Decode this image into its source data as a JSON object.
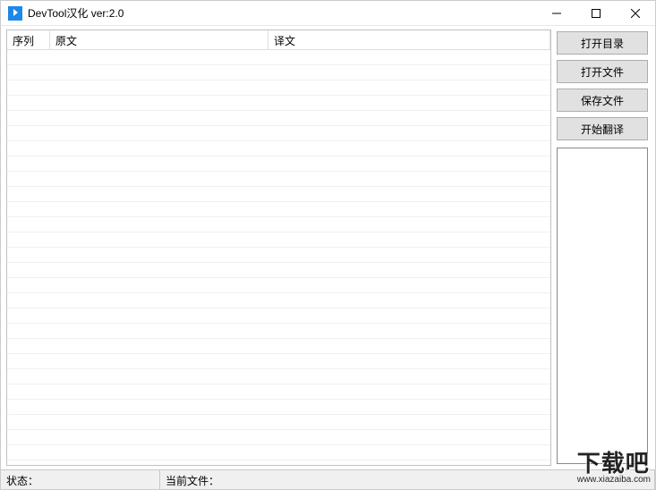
{
  "window": {
    "title": "DevTool汉化 ver:2.0"
  },
  "table": {
    "columns": {
      "seq": "序列",
      "original": "原文",
      "translated": "译文"
    }
  },
  "sidebar": {
    "open_dir": "打开目录",
    "open_file": "打开文件",
    "save_file": "保存文件",
    "start_translate": "开始翻译"
  },
  "statusbar": {
    "state_label": "状态：",
    "current_file_label": "当前文件：",
    "state_value": "",
    "current_file_value": ""
  },
  "watermark": {
    "brand": "下载吧",
    "url": "www.xiazaiba.com"
  }
}
